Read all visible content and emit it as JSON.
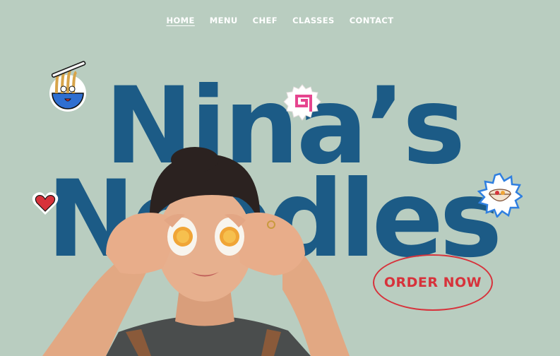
{
  "nav": {
    "items": [
      {
        "label": "HOME",
        "active": true
      },
      {
        "label": "MENU"
      },
      {
        "label": "CHEF"
      },
      {
        "label": "CLASSES"
      },
      {
        "label": "CONTACT"
      }
    ]
  },
  "hero": {
    "title_line1": "Nina’s",
    "title_line2": "Noodles",
    "cta_label": "ORDER NOW"
  },
  "icons": [
    "ramen-sticker-icon",
    "narutomaki-sticker-icon",
    "heart-sticker-icon",
    "ramen-bowl-sticker-icon"
  ],
  "colors": {
    "background": "#b9cdc0",
    "title": "#1c5b86",
    "accent": "#d7323b",
    "nav_text": "#ffffff"
  }
}
